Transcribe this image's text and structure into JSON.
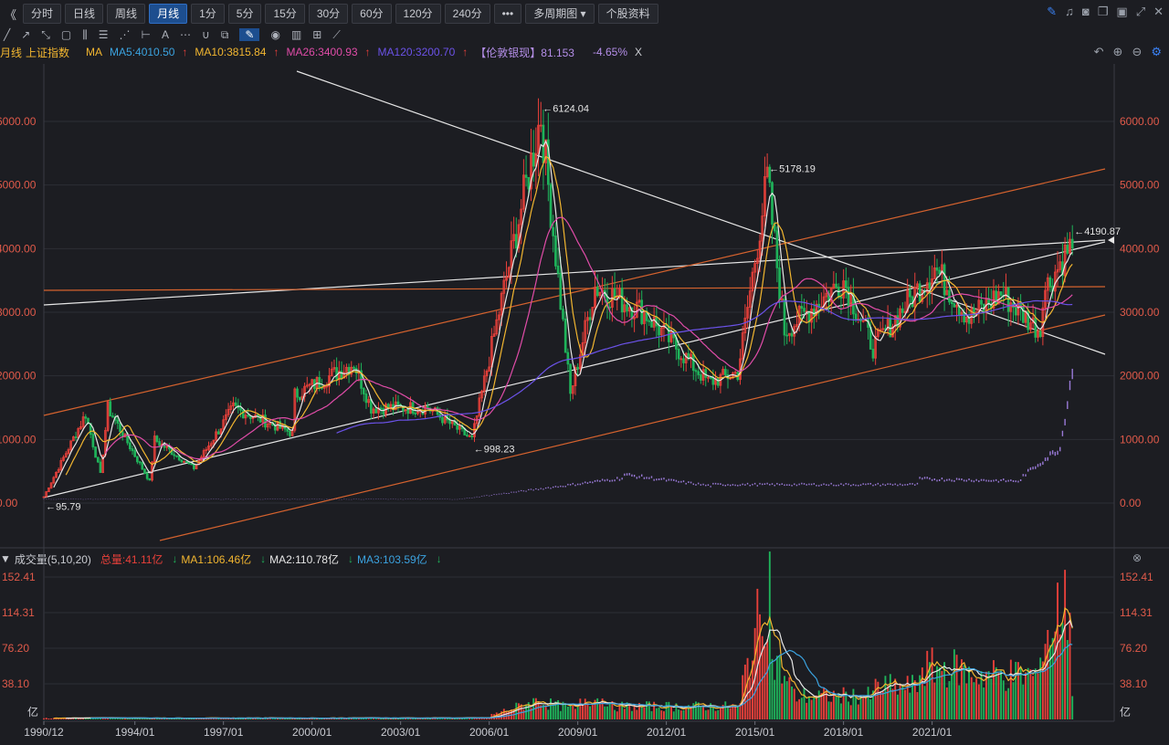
{
  "toolbar": {
    "nav_left": "《",
    "periods": [
      "分时",
      "日线",
      "周线",
      "月线",
      "1分",
      "5分",
      "15分",
      "30分",
      "60分",
      "120分",
      "240分"
    ],
    "active_period": "月线",
    "more": "•••",
    "multi": "多周期图",
    "profile": "个股资料",
    "right_icons": [
      "edit-icon",
      "bell-icon",
      "camera-icon",
      "copy-icon",
      "monitor-icon",
      "fullscreen-icon",
      "close-icon"
    ]
  },
  "drawtools": [
    "line-tool-icon",
    "ray-tool-icon",
    "segment-tool-icon",
    "rect-tool-icon",
    "candle-tool-icon",
    "fib-tool-icon",
    "fan-tool-icon",
    "measure-tool-icon",
    "text-tool-icon",
    "more-tools-icon",
    "magnet-icon",
    "clone-icon",
    "pencil-icon",
    "eye-icon",
    "trash-icon",
    "layers-icon",
    "ruler-icon"
  ],
  "legend": {
    "period": "月线",
    "name": "上证指数",
    "ma": "MA",
    "ma5": "MA5:4010.50",
    "ma10": "MA10:3815.84",
    "ma26": "MA26:3400.93",
    "ma120": "MA120:3200.70",
    "indicator": "【伦敦银现】81.153",
    "change": "-4.65%",
    "close": "X",
    "up_arrow": "↑"
  },
  "vol_legend": {
    "title": "成交量(5,10,20)",
    "total": "总量:41.11亿",
    "ma1": "MA1:106.46亿",
    "ma2": "MA2:110.78亿",
    "ma3": "MA3:103.59亿",
    "down_arrow": "↓"
  },
  "colors": {
    "up": "#e8403a",
    "down": "#1fb35a",
    "ma5": "#e6e6e6",
    "ma10": "#f2b630",
    "ma26": "#e04ca8",
    "ma120": "#6b52e8",
    "silver": "#9a7ad8",
    "axis": "#e05a4a",
    "vma1": "#f2b630",
    "vma2": "#e6e6e6",
    "vma3": "#3ba3e0"
  },
  "chart_data": [
    {
      "type": "candlestick",
      "title": "上证指数 月线",
      "y_ticks": [
        "0.00",
        "1000.00",
        "2000.00",
        "3000.00",
        "4000.00",
        "5000.00",
        "6000.00"
      ],
      "ylim": [
        0,
        6000
      ],
      "x_ticks": [
        "1990/12",
        "1994/01",
        "1997/01",
        "2000/01",
        "2003/01",
        "2006/01",
        "2009/01",
        "2012/01",
        "2015/01",
        "2018/01",
        "2021/01"
      ],
      "annotations": [
        {
          "label": "6124.04",
          "date": "2007/10",
          "value": 6124.04
        },
        {
          "label": "5178.19",
          "date": "2015/06",
          "value": 5178.19
        },
        {
          "label": "4190.87",
          "date": "2025/10",
          "value": 4190.87
        },
        {
          "label": "998.23",
          "date": "2005/06",
          "value": 998.23
        },
        {
          "label": "95.79",
          "date": "1990/12",
          "value": 95.79
        }
      ],
      "monthly_close_anchors": [
        [
          "1990/12",
          100
        ],
        [
          "1992/05",
          1400
        ],
        [
          "1992/11",
          450
        ],
        [
          "1993/02",
          1500
        ],
        [
          "1994/07",
          340
        ],
        [
          "1994/09",
          1000
        ],
        [
          "1996/01",
          550
        ],
        [
          "1997/05",
          1500
        ],
        [
          "1999/05",
          1100
        ],
        [
          "1999/06",
          1700
        ],
        [
          "2001/06",
          2200
        ],
        [
          "2002/01",
          1500
        ],
        [
          "2003/12",
          1500
        ],
        [
          "2005/06",
          1000
        ],
        [
          "2007/10",
          6100
        ],
        [
          "2008/10",
          1700
        ],
        [
          "2009/08",
          3400
        ],
        [
          "2011/04",
          3000
        ],
        [
          "2013/06",
          1900
        ],
        [
          "2014/06",
          2050
        ],
        [
          "2015/06",
          5100
        ],
        [
          "2016/01",
          2700
        ],
        [
          "2018/01",
          3500
        ],
        [
          "2019/01",
          2450
        ],
        [
          "2021/02",
          3700
        ],
        [
          "2022/04",
          2900
        ],
        [
          "2023/05",
          3300
        ],
        [
          "2024/09",
          2700
        ],
        [
          "2024/10",
          3300
        ],
        [
          "2025/10",
          4100
        ]
      ],
      "moving_averages": [
        {
          "name": "MA5",
          "value": 4010.5
        },
        {
          "name": "MA10",
          "value": 3815.84
        },
        {
          "name": "MA26",
          "value": 3400.93
        },
        {
          "name": "MA120",
          "value": 3200.7
        }
      ],
      "overlay": {
        "name": "伦敦银现",
        "value": 81.153,
        "last": 2100
      }
    },
    {
      "type": "bar",
      "title": "成交量(5,10,20)",
      "y_ticks": [
        "38.10",
        "76.20",
        "114.31",
        "152.41"
      ],
      "ylim": [
        0,
        152.41
      ],
      "unit": "亿",
      "series": [
        {
          "name": "MA1",
          "value": 106.46
        },
        {
          "name": "MA2",
          "value": 110.78
        },
        {
          "name": "MA3",
          "value": 103.59
        }
      ]
    }
  ]
}
